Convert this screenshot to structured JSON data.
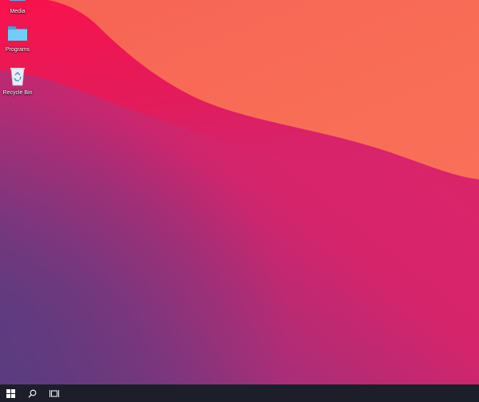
{
  "desktop": {
    "icons": [
      {
        "label": "Media",
        "icon": "media-icon"
      },
      {
        "label": "Programs",
        "icon": "folder-icon"
      },
      {
        "label": "Recycle Bin",
        "icon": "recycle-bin-icon"
      }
    ]
  },
  "taskbar": {
    "buttons": [
      {
        "icon": "windows-start-icon"
      },
      {
        "icon": "search-icon"
      },
      {
        "icon": "task-view-icon"
      }
    ],
    "color": "#1c1e2a"
  },
  "theme": {
    "wallpaper_colors": [
      "#f76e55",
      "#f8124c",
      "#d2236f",
      "#6b3b80"
    ]
  }
}
